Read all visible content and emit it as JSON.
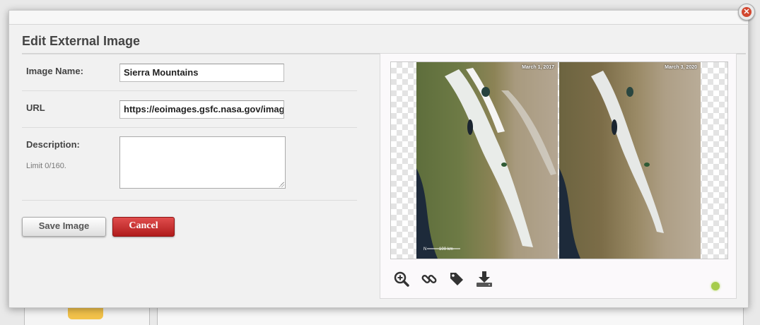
{
  "dialog": {
    "title": "Edit External Image"
  },
  "form": {
    "image_name_label": "Image Name:",
    "image_name_value": "Sierra Mountains",
    "url_label": "URL",
    "url_value": "https://eoimages.gsfc.nasa.gov/imag",
    "description_label": "Description:",
    "description_limit": "Limit 0/160.",
    "description_value": ""
  },
  "buttons": {
    "save_label": "Save Image",
    "cancel_label": "Cancel",
    "close_glyph": "✕"
  },
  "preview": {
    "left_date": "March 1, 2017",
    "right_date": "March 3, 2020",
    "scale_label": "100 km",
    "north_label": "N",
    "tools": [
      "zoom-in-icon",
      "link-icon",
      "tag-icon",
      "download-icon"
    ],
    "status_color": "#a6cc4a"
  },
  "colors": {
    "cancel": "#c62828",
    "panel_bg": "#f1f1f1"
  }
}
